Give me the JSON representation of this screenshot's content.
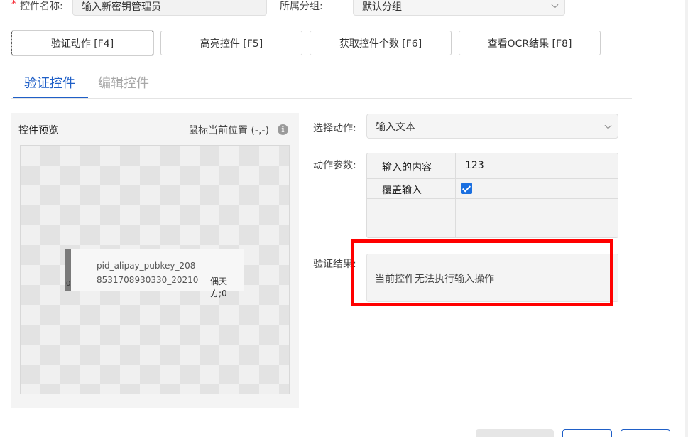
{
  "form": {
    "required_mark": "*",
    "name_label": "控件名称:",
    "name_value": "输入新密钥管理员",
    "group_label": "所属分组:",
    "group_value": "默认分组"
  },
  "toolbar": {
    "verify_action": "验证动作 [F4]",
    "highlight": "高亮控件 [F5]",
    "count": "获取控件个数 [F6]",
    "ocr": "查看OCR结果 [F8]"
  },
  "tabs": [
    {
      "label": "验证控件",
      "active": true
    },
    {
      "label": "编辑控件",
      "active": false
    }
  ],
  "preview": {
    "title": "控件预览",
    "mouse_pos": "鼠标当前位置 (-,-)",
    "snippet_line1": "pid_alipay_pubkey_208",
    "snippet_line2": "8531708930330_20210",
    "snippet_right": "偶天方;0",
    "snippet_digit": "0"
  },
  "action": {
    "select_label": "选择动作:",
    "select_value": "输入文本",
    "params_label": "动作参数:",
    "params": [
      {
        "name": "输入的内容",
        "value": "123"
      },
      {
        "name": "覆盖输入",
        "value": "",
        "checked": true
      },
      {
        "name": "",
        "value": ""
      }
    ]
  },
  "result": {
    "label": "验证结果:",
    "message": "当前控件无法执行输入操作"
  },
  "colors": {
    "accent": "#1f5fc7",
    "highlight_frame": "#ff0000",
    "checkbox": "#1a6fe0"
  }
}
